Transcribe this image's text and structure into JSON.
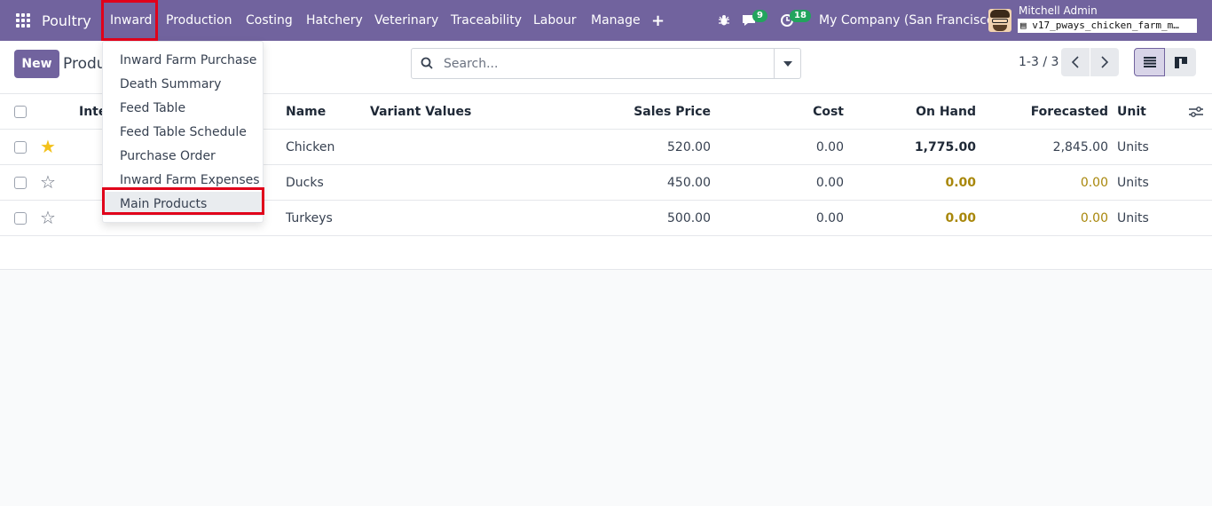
{
  "navbar": {
    "brand": "Poultry",
    "menus": [
      "Inward",
      "Production",
      "Costing",
      "Hatchery",
      "Veterinary",
      "Traceability",
      "Labour",
      "Manage"
    ],
    "messages_count": "9",
    "activities_count": "18",
    "company": "My Company (San Francisco)",
    "user_name": "Mitchell Admin",
    "database": "v17_pways_chicken_farm_m…"
  },
  "inward_menu": {
    "items": [
      "Inward Farm Purchase",
      "Death Summary",
      "Feed Table",
      "Feed Table Schedule",
      "Purchase Order",
      "Inward Farm Expenses",
      "Main Products"
    ]
  },
  "control": {
    "new_label": "New",
    "breadcrumb": "Produ",
    "search_placeholder": "Search...",
    "pager": "1-3 / 3"
  },
  "table": {
    "headers": {
      "internal_ref": "Inte",
      "name": "Name",
      "variant_values": "Variant Values",
      "sales_price": "Sales Price",
      "cost": "Cost",
      "on_hand": "On Hand",
      "forecasted": "Forecasted",
      "unit": "Unit"
    },
    "rows": [
      {
        "favorite": true,
        "name": "Chicken",
        "sales_price": "520.00",
        "cost": "0.00",
        "on_hand": "1,775.00",
        "forecasted": "2,845.00",
        "unit": "Units"
      },
      {
        "favorite": false,
        "name": "Ducks",
        "sales_price": "450.00",
        "cost": "0.00",
        "on_hand": "0.00",
        "forecasted": "0.00",
        "unit": "Units"
      },
      {
        "favorite": false,
        "name": "Turkeys",
        "sales_price": "500.00",
        "cost": "0.00",
        "on_hand": "0.00",
        "forecasted": "0.00",
        "unit": "Units"
      }
    ]
  },
  "colors": {
    "brand": "#71639e",
    "highlight": "#e0001a",
    "badge": "#22a45d",
    "favorite_star": "#f3c11b",
    "warning_qty": "#a8870b"
  }
}
